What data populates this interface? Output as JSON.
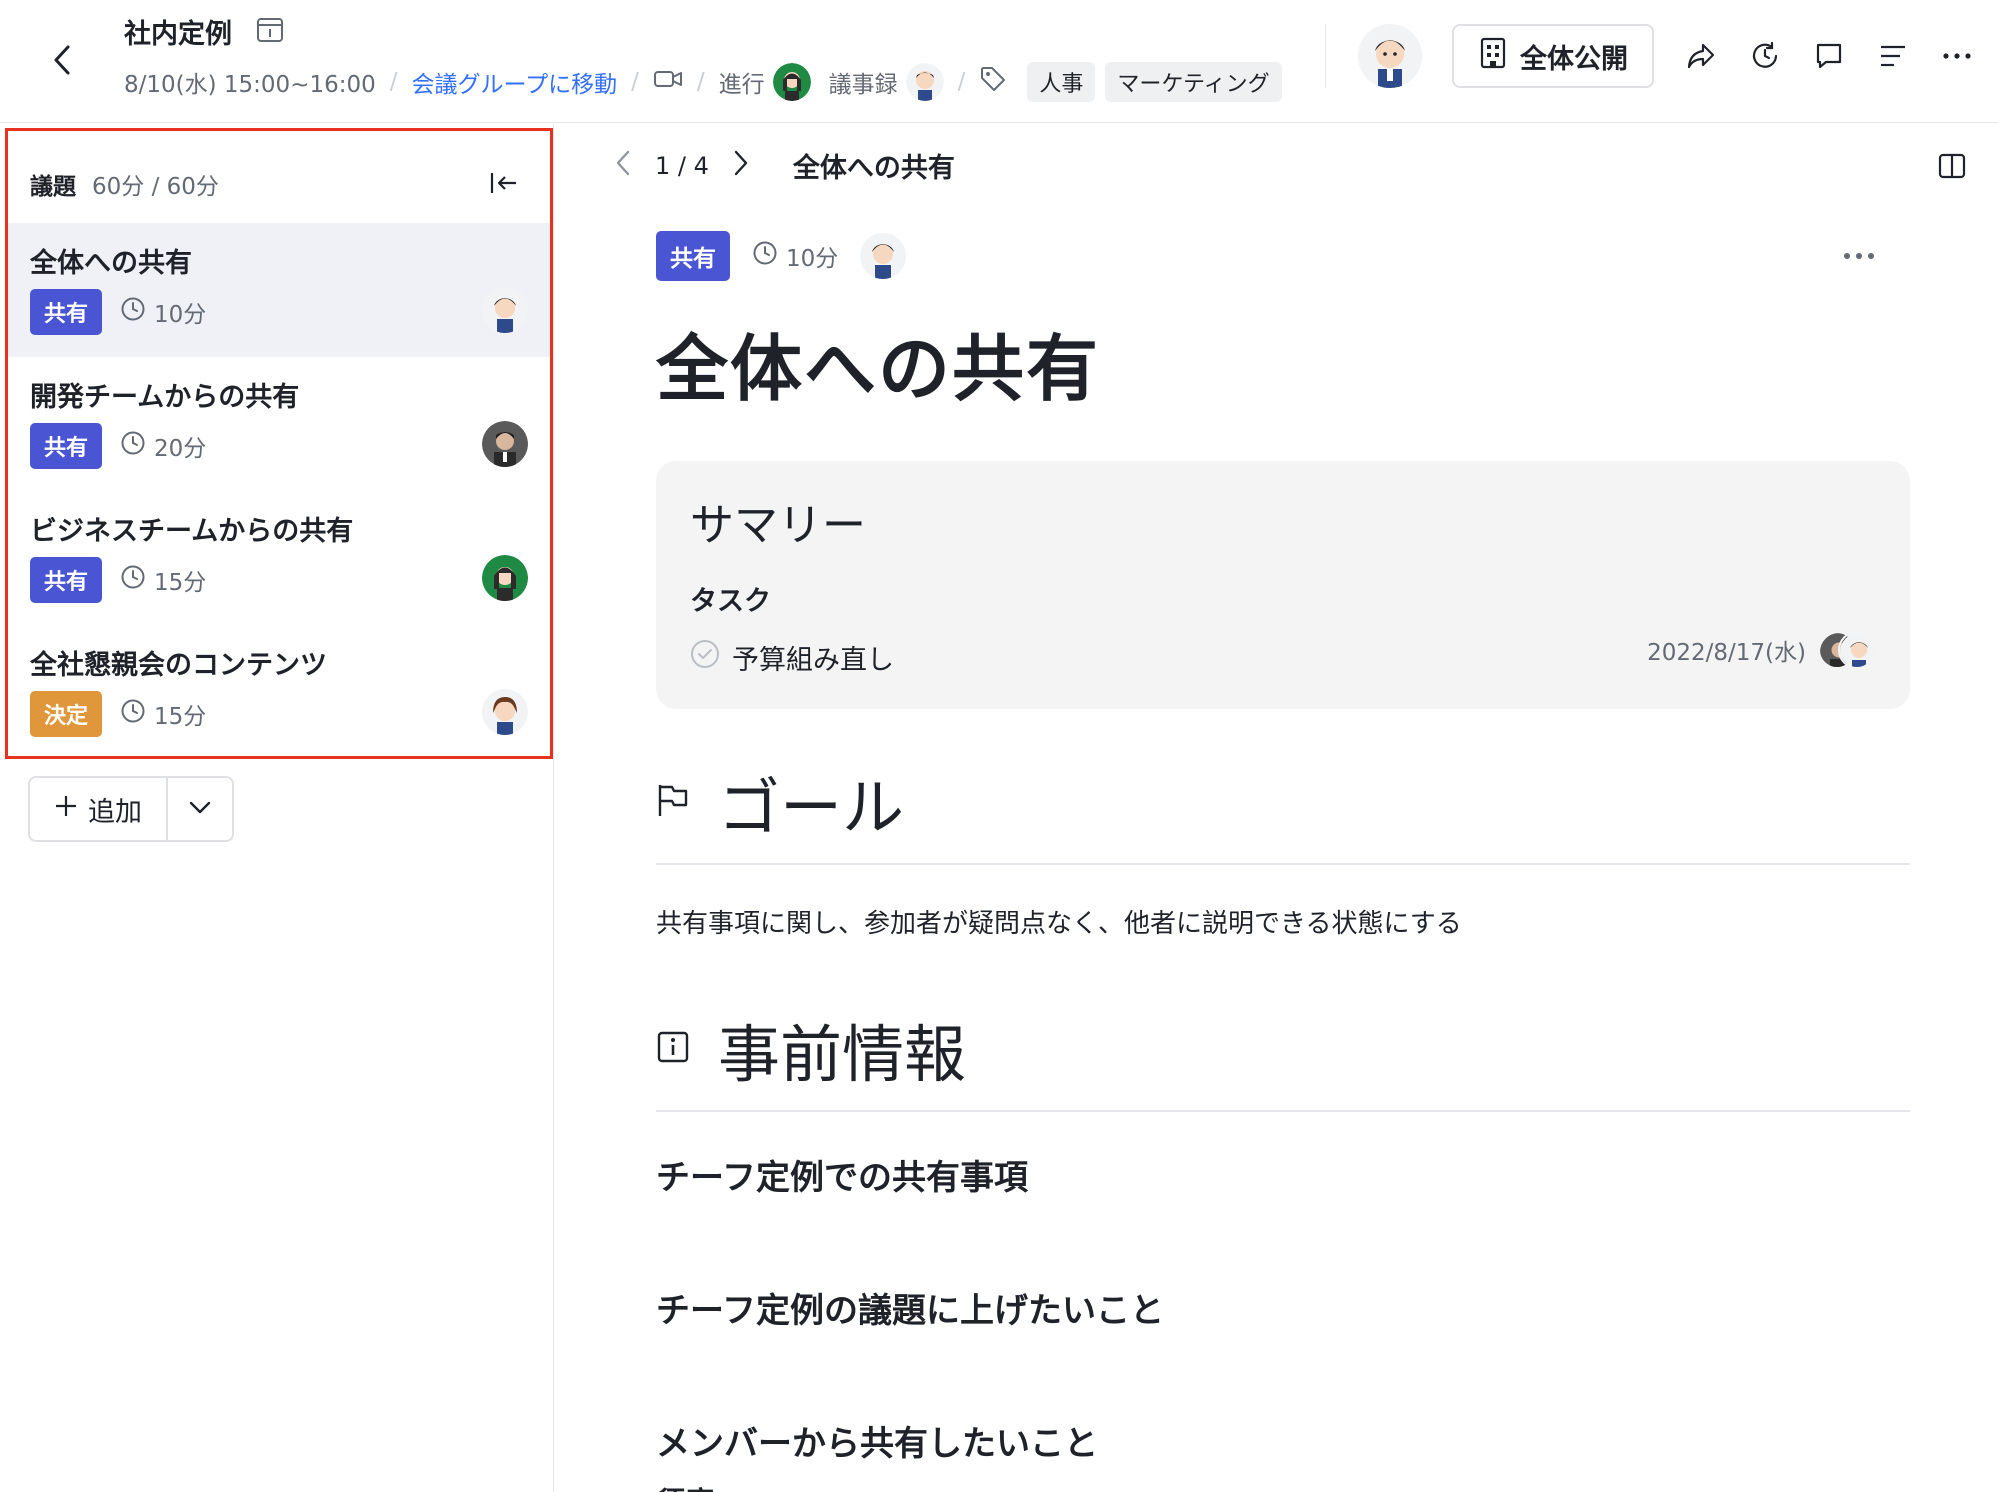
{
  "header": {
    "title": "社内定例",
    "datetime": "8/10(水) 15:00~16:00",
    "group_link": "会議グループに移動",
    "facilitator_label": "進行",
    "minutes_label": "議事録",
    "tags": [
      "人事",
      "マーケティング"
    ],
    "public_label": "全体公開"
  },
  "agenda": {
    "label": "議題",
    "time": "60分 / 60分",
    "items": [
      {
        "title": "全体への共有",
        "badge": "共有",
        "duration": "10分"
      },
      {
        "title": "開発チームからの共有",
        "badge": "共有",
        "duration": "20分"
      },
      {
        "title": "ビジネスチームからの共有",
        "badge": "共有",
        "duration": "15分"
      },
      {
        "title": "全社懇親会のコンテンツ",
        "badge": "決定",
        "duration": "15分"
      }
    ],
    "add_label": "追加"
  },
  "main": {
    "pager": "1 / 4",
    "pager_title": "全体への共有",
    "badge": "共有",
    "duration": "10分",
    "title": "全体への共有",
    "summary": {
      "heading": "サマリー",
      "task_label": "タスク",
      "task": "予算組み直し",
      "task_date": "2022/8/17(水)"
    },
    "goal_heading": "ゴール",
    "goal_text": "共有事項に関し、参加者が疑問点なく、他者に説明できる状態にする",
    "info_heading": "事前情報",
    "sub1": "チーフ定例での共有事項",
    "sub2": "チーフ定例の議題に上げたいこと",
    "sub3": "メンバーから共有したいこと",
    "sub3_name": "須磨"
  },
  "colors": {
    "share_badge": "#4a55d4",
    "decide_badge": "#e0963a",
    "highlight_border": "#e8321e",
    "link": "#3370ff"
  }
}
